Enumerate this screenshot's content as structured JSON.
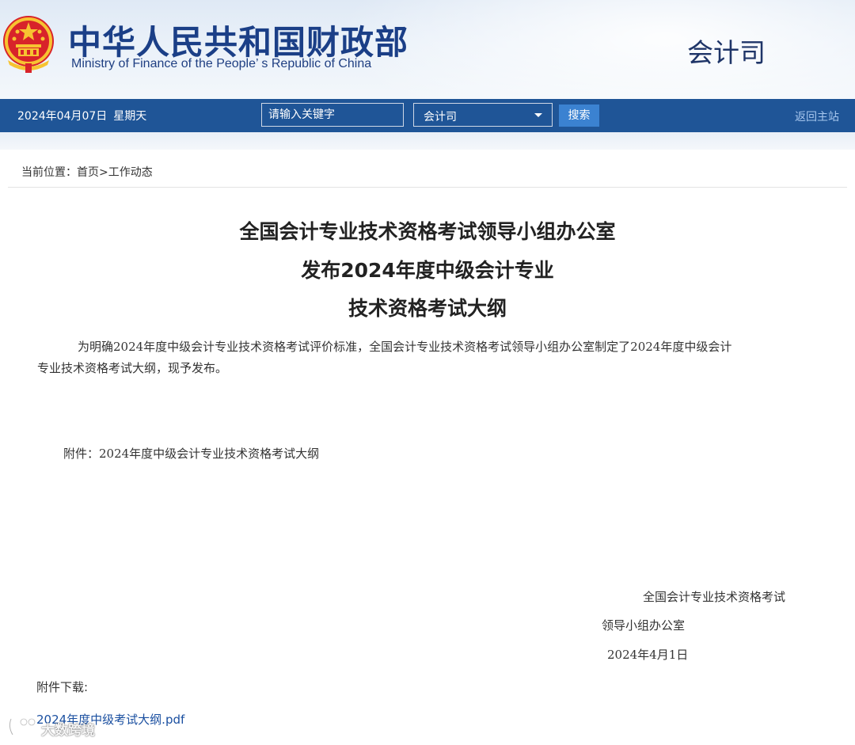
{
  "header": {
    "ministry_cn": "中华人民共和国财政部",
    "ministry_en": "Ministry of Finance of the People’ s Republic of China",
    "department": "会计司",
    "emblem_icon": "national-emblem-icon"
  },
  "navbar": {
    "date": "2024年04月07日",
    "weekday": "星期天",
    "search_placeholder": "请输入关键字",
    "scope_select": "会计司",
    "search_button": "搜索",
    "home_link": "返回主站"
  },
  "breadcrumb": {
    "label": "当前位置：",
    "home": "首页",
    "separator": ">",
    "current": "工作动态"
  },
  "article": {
    "title_lines": [
      "全国会计专业技术资格考试领导小组办公室",
      "发布2024年度中级会计专业",
      "技术资格考试大纲"
    ],
    "paragraph_line1": "为明确2024年度中级会计专业技术资格考试评价标准，全国会计专业技术资格考试领导小组办公室制定了2024年度中级会计",
    "paragraph_line2": "专业技术资格考试大纲，现予发布。",
    "attachment_note": "附件：2024年度中级会计专业技术资格考试大纲",
    "signature_line1": "全国会计专业技术资格考试",
    "signature_line2": "领导小组办公室",
    "signature_date": "2024年4月1日"
  },
  "downloads": {
    "label": "附件下载:",
    "file_name": "2024年度中级考试大纲.pdf"
  },
  "watermark": {
    "text": "大数跨境"
  },
  "colors": {
    "navbar": "#1f5597",
    "title_blue": "#1b3f87",
    "link_blue": "#1a4fa0",
    "button_blue": "#3b82d1"
  }
}
